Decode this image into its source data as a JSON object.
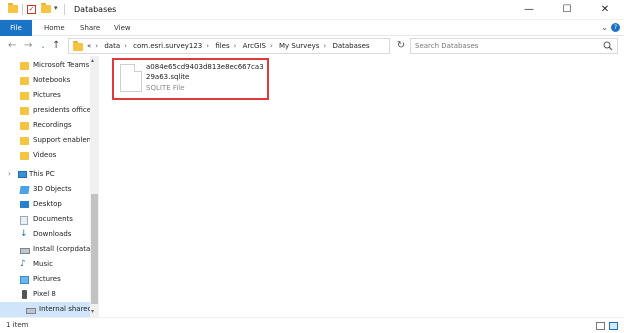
{
  "window": {
    "title": "Databases",
    "minimize": "—",
    "maximize": "☐",
    "close": "✕"
  },
  "ribbon": {
    "tabs": [
      "File",
      "Home",
      "Share",
      "View"
    ]
  },
  "address": {
    "crumbs": [
      "«",
      "data",
      "com.esri.survey123",
      "files",
      "ArcGIS",
      "My Surveys",
      "Databases"
    ],
    "search_placeholder": "Search Databases"
  },
  "sidebar": {
    "items": [
      {
        "label": "Microsoft Teams",
        "icon": "folder-icon"
      },
      {
        "label": "Notebooks",
        "icon": "folder-icon"
      },
      {
        "label": "Pictures",
        "icon": "folder-icon"
      },
      {
        "label": "presidents office",
        "icon": "folder-icon"
      },
      {
        "label": "Recordings",
        "icon": "folder-icon"
      },
      {
        "label": "Support enablen",
        "icon": "folder-icon"
      },
      {
        "label": "Videos",
        "icon": "folder-icon"
      },
      {
        "label": "This PC",
        "icon": "pc-icon"
      },
      {
        "label": "3D Objects",
        "icon": "objects-3d-icon"
      },
      {
        "label": "Desktop",
        "icon": "desktop-icon"
      },
      {
        "label": "Documents",
        "icon": "documents-icon"
      },
      {
        "label": "Downloads",
        "icon": "downloads-icon"
      },
      {
        "label": "Install (corpdata",
        "icon": "network-drive-icon"
      },
      {
        "label": "Music",
        "icon": "music-icon"
      },
      {
        "label": "Pictures",
        "icon": "pictures-icon"
      },
      {
        "label": "Pixel 8",
        "icon": "phone-icon"
      },
      {
        "label": "Internal shared",
        "icon": "drive-icon"
      }
    ]
  },
  "content": {
    "file": {
      "name": "a084e65cd9403d813e8ec667ca329a63.sqlite",
      "type": "SQLITE File"
    }
  },
  "status": {
    "text": "1 item"
  },
  "colors": {
    "accent": "#1a73c5",
    "highlight": "#e0393e",
    "folder": "#f5c542"
  }
}
